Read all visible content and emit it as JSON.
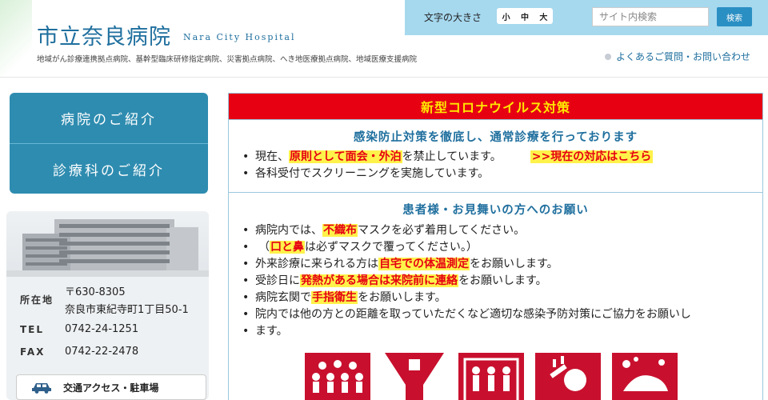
{
  "header": {
    "logo_ja": "市立奈良病院",
    "logo_en": "Nara City Hospital",
    "tagline": "地域がん診療連携拠点病院、基幹型臨床研修指定病院、災害拠点病院、へき地医療拠点病院、地域医療支援病院",
    "font_size_label": "文字の大きさ",
    "font_small": "小",
    "font_medium": "中",
    "font_large": "大",
    "search_placeholder": "サイト内検索",
    "search_button": "検索",
    "faq_link": "よくあるご質問・お問い合わせ"
  },
  "sidebar": {
    "nav": [
      {
        "label": "病院のご紹介"
      },
      {
        "label": "診療科のご紹介"
      }
    ],
    "info": {
      "address_label": "所在地",
      "postal": "〒630-8305",
      "address": "奈良市東紀寺町1丁目50-1",
      "tel_label": "TEL",
      "tel": "0742-24-1251",
      "fax_label": "FAX",
      "fax": "0742-22-2478",
      "access_label": "交通アクセス・駐車場"
    }
  },
  "notice": {
    "title": "新型コロナウイルス対策",
    "section1": {
      "heading": "感染防止対策を徹底し、通常診療を行っております",
      "b1_pre": "現在、",
      "b1_hl": "原則として面会・外泊",
      "b1_post": "を禁止しています。",
      "b1_link": ">>現在の対応はこちら",
      "b2": "各科受付でスクリーニングを実施しています。"
    },
    "section2": {
      "heading": "患者様・お見舞いの方へのお願い",
      "b1_pre": "病院内では、",
      "b1_hl": "不織布",
      "b1_post": "マスクを必ず着用してください。",
      "b1_sub_pre": "（",
      "b1_sub_hl": "口と鼻",
      "b1_sub_post": "は必ずマスクで覆ってください。）",
      "b2_pre": "外来診療に来られる方は",
      "b2_hl": "自宅での体温測定",
      "b2_post": "をお願いします。",
      "b3_pre": "受診日に",
      "b3_hl": "発熱がある場合は来院前に連絡",
      "b3_post": "をお願いします。",
      "b4_pre": "病院玄関で",
      "b4_hl": "手指衛生",
      "b4_post": "をお願いします。",
      "b5_line1": "院内では他の方との距離を取っていただくなど適切な感染予防対策にご協力をお願いし",
      "b5_line2": "ます。"
    }
  },
  "colors": {
    "brand_blue": "#1f6f9e",
    "nav_blue": "#2e8cb0",
    "notice_red": "#e60012",
    "highlight_yellow": "#fff24a",
    "util_bar": "#a6d8ee"
  },
  "icons": [
    "crowd-icon",
    "funnel-icon",
    "distancing-icon",
    "cough-icon",
    "handwash-icon"
  ]
}
